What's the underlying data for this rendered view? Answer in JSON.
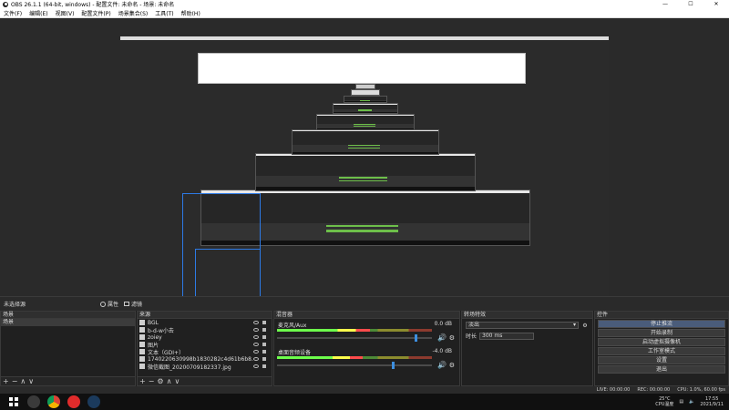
{
  "window": {
    "title": "OBS 26.1.1 (64-bit, windows) - 配置文件: 未命名 - 场景: 未命名",
    "minimize": "—",
    "maximize": "☐",
    "close": "✕"
  },
  "menu": [
    "文件(F)",
    "编辑(E)",
    "视图(V)",
    "配置文件(P)",
    "场景集合(S)",
    "工具(T)",
    "帮助(H)"
  ],
  "dock_header": {
    "no_selection": "未选择源",
    "properties_label": "属性",
    "filters_label": "滤镜"
  },
  "scenes": {
    "header": "场景",
    "items": [
      "场景"
    ]
  },
  "sources": {
    "header": "来源",
    "items": [
      "BGL",
      "b-d-w小去",
      "zoiey",
      "图片",
      "文本（GDI+）",
      "1740220630998b1830282c4d61b6b8.png",
      "微信截图_20200709182337.jpg"
    ]
  },
  "mixer": {
    "header": "混音器",
    "channels": [
      {
        "name": "麦克风/Aux",
        "db": "0.0 dB",
        "level": 0.6,
        "fader": 0.9
      },
      {
        "name": "桌面音频设备",
        "db": "-4.0 dB",
        "level": 0.55,
        "fader": 0.75
      }
    ]
  },
  "transitions": {
    "header": "转场特效",
    "selected": "淡出",
    "duration_label": "时长",
    "duration": "300 ms"
  },
  "controls": {
    "header": "控件",
    "buttons": [
      "停止推流",
      "开始录制",
      "启动虚拟摄像机",
      "工作室模式",
      "设置",
      "退出"
    ]
  },
  "footer_icons": {
    "add": "+",
    "remove": "−",
    "up": "∧",
    "down": "∨",
    "gear": "⚙"
  },
  "statusbar": {
    "live": "LIVE: 00:00:00",
    "rec": "REC: 00:00:00",
    "cpu": "CPU: 1.0%, 60.00 fps"
  },
  "taskbar": {
    "weather_temp": "25°C",
    "weather_label": "CPU温度",
    "time": "17:55",
    "date": "2021/9/11"
  },
  "colors": {
    "accent": "#2d7ae5",
    "meter_green": "#6dff4c",
    "meter_yellow": "#ffff4c",
    "meter_red": "#ff4c4c",
    "panel_bg": "#202020"
  }
}
